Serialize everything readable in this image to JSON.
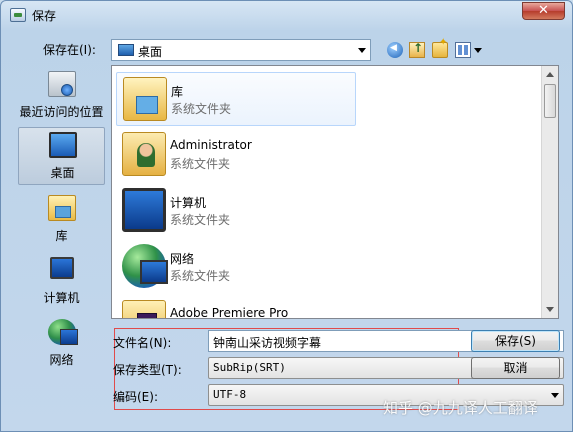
{
  "window": {
    "title": "保存",
    "close_label": "✕"
  },
  "toolbar": {
    "save_in_label": "保存在(I):",
    "location": "桌面"
  },
  "places": [
    {
      "label": "最近访问的位置",
      "icon": "recent-places-icon"
    },
    {
      "label": "桌面",
      "icon": "desktop-icon",
      "selected": true
    },
    {
      "label": "库",
      "icon": "library-icon"
    },
    {
      "label": "计算机",
      "icon": "computer-icon"
    },
    {
      "label": "网络",
      "icon": "network-icon"
    }
  ],
  "files": [
    {
      "name": "库",
      "type": "系统文件夹",
      "icon": "library-folder-icon"
    },
    {
      "name": "Administrator",
      "type": "系统文件夹",
      "icon": "user-folder-icon"
    },
    {
      "name": "计算机",
      "type": "系统文件夹",
      "icon": "computer-icon"
    },
    {
      "name": "网络",
      "type": "系统文件夹",
      "icon": "network-icon"
    },
    {
      "name": "Adobe Premiere Pro",
      "type": "",
      "icon": "premiere-folder-icon"
    }
  ],
  "form": {
    "filename_label": "文件名(N):",
    "filename_value": "钟南山采访视频字幕",
    "filetype_label": "保存类型(T):",
    "filetype_value": "SubRip(SRT)",
    "encoding_label": "编码(E):",
    "encoding_value": "UTF-8"
  },
  "buttons": {
    "save": "保存(S)",
    "cancel": "取消"
  },
  "watermark": "知乎 @九九译人工翻译",
  "colors": {
    "highlight_border": "#e04b4b",
    "window_bg": "#c3d7ec"
  }
}
